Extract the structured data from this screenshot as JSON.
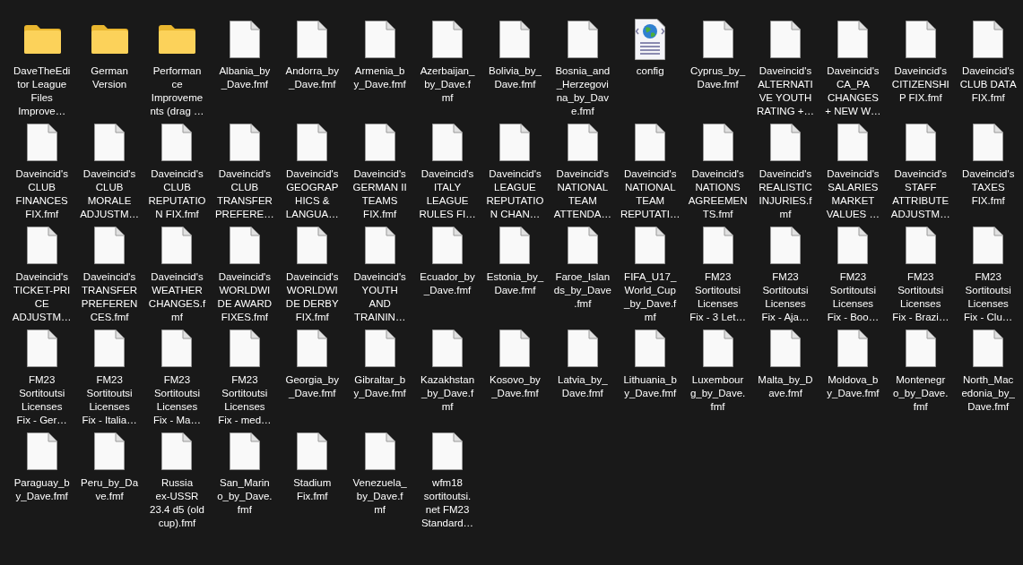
{
  "items": [
    {
      "kind": "folder",
      "lines": [
        "DaveTheEdi",
        "tor League",
        "Files",
        "Improve…"
      ]
    },
    {
      "kind": "folder",
      "lines": [
        "German",
        "Version"
      ]
    },
    {
      "kind": "folder",
      "lines": [
        "Performan",
        "ce",
        "Improveme",
        "nts (drag …"
      ]
    },
    {
      "kind": "file",
      "lines": [
        "Albania_by",
        "_Dave.fmf"
      ]
    },
    {
      "kind": "file",
      "lines": [
        "Andorra_by",
        "_Dave.fmf"
      ]
    },
    {
      "kind": "file",
      "lines": [
        "Armenia_b",
        "y_Dave.fmf"
      ]
    },
    {
      "kind": "file",
      "lines": [
        "Azerbaijan_",
        "by_Dave.f",
        "mf"
      ]
    },
    {
      "kind": "file",
      "lines": [
        "Bolivia_by_",
        "Dave.fmf"
      ]
    },
    {
      "kind": "file",
      "lines": [
        "Bosnia_and",
        "_Herzegovi",
        "na_by_Dav",
        "e.fmf"
      ]
    },
    {
      "kind": "web",
      "lines": [
        "config"
      ]
    },
    {
      "kind": "file",
      "lines": [
        "Cyprus_by_",
        "Dave.fmf"
      ]
    },
    {
      "kind": "file",
      "lines": [
        "Daveincid's",
        "ALTERNATI",
        "VE YOUTH",
        "RATING +…"
      ]
    },
    {
      "kind": "file",
      "lines": [
        "Daveincid's",
        "CA_PA",
        "CHANGES",
        "+ NEW W…"
      ]
    },
    {
      "kind": "file",
      "lines": [
        "Daveincid's",
        "CITIZENSHI",
        "P FIX.fmf"
      ]
    },
    {
      "kind": "file",
      "lines": [
        "Daveincid's",
        "CLUB DATA",
        "FIX.fmf"
      ]
    },
    {
      "kind": "file",
      "lines": [
        "Daveincid's",
        "CLUB",
        "FINANCES",
        "FIX.fmf"
      ]
    },
    {
      "kind": "file",
      "lines": [
        "Daveincid's",
        "CLUB",
        "MORALE",
        "ADJUSTM…"
      ]
    },
    {
      "kind": "file",
      "lines": [
        "Daveincid's",
        "CLUB",
        "REPUTATIO",
        "N FIX.fmf"
      ]
    },
    {
      "kind": "file",
      "lines": [
        "Daveincid's",
        "CLUB",
        "TRANSFER",
        "PREFERE…"
      ]
    },
    {
      "kind": "file",
      "lines": [
        "Daveincid's",
        "GEOGRAP",
        "HICS &",
        "LANGUA…"
      ]
    },
    {
      "kind": "file",
      "lines": [
        "Daveincid's",
        "GERMAN II",
        "TEAMS",
        "FIX.fmf"
      ]
    },
    {
      "kind": "file",
      "lines": [
        "Daveincid's",
        "ITALY",
        "LEAGUE",
        "RULES FI…"
      ]
    },
    {
      "kind": "file",
      "lines": [
        "Daveincid's",
        "LEAGUE",
        "REPUTATIO",
        "N CHAN…"
      ]
    },
    {
      "kind": "file",
      "lines": [
        "Daveincid's",
        "NATIONAL",
        "TEAM",
        "ATTENDA…"
      ]
    },
    {
      "kind": "file",
      "lines": [
        "Daveincid's",
        "NATIONAL",
        "TEAM",
        "REPUTATI…"
      ]
    },
    {
      "kind": "file",
      "lines": [
        "Daveincid's",
        "NATIONS",
        "AGREEMEN",
        "TS.fmf"
      ]
    },
    {
      "kind": "file",
      "lines": [
        "Daveincid's",
        "REALISTIC",
        "INJURIES.f",
        "mf"
      ]
    },
    {
      "kind": "file",
      "lines": [
        "Daveincid's",
        "SALARIES",
        "MARKET",
        "VALUES …"
      ]
    },
    {
      "kind": "file",
      "lines": [
        "Daveincid's",
        "STAFF",
        "ATTRIBUTE",
        "ADJUSTM…"
      ]
    },
    {
      "kind": "file",
      "lines": [
        "Daveincid's",
        "TAXES",
        "FIX.fmf"
      ]
    },
    {
      "kind": "file",
      "lines": [
        "Daveincid's",
        "TICKET-PRI",
        "CE",
        "ADJUSTM…"
      ]
    },
    {
      "kind": "file",
      "lines": [
        "Daveincid's",
        "TRANSFER",
        "PREFEREN",
        "CES.fmf"
      ]
    },
    {
      "kind": "file",
      "lines": [
        "Daveincid's",
        "WEATHER",
        "CHANGES.f",
        "mf"
      ]
    },
    {
      "kind": "file",
      "lines": [
        "Daveincid's",
        "WORLDWI",
        "DE AWARD",
        "FIXES.fmf"
      ]
    },
    {
      "kind": "file",
      "lines": [
        "Daveincid's",
        "WORLDWI",
        "DE DERBY",
        "FIX.fmf"
      ]
    },
    {
      "kind": "file",
      "lines": [
        "Daveincid's",
        "YOUTH",
        "AND",
        "TRAININ…"
      ]
    },
    {
      "kind": "file",
      "lines": [
        "Ecuador_by",
        "_Dave.fmf"
      ]
    },
    {
      "kind": "file",
      "lines": [
        "Estonia_by_",
        "Dave.fmf"
      ]
    },
    {
      "kind": "file",
      "lines": [
        "Faroe_Islan",
        "ds_by_Dave",
        ".fmf"
      ]
    },
    {
      "kind": "file",
      "lines": [
        "FIFA_U17_",
        "World_Cup",
        "_by_Dave.f",
        "mf"
      ]
    },
    {
      "kind": "file",
      "lines": [
        "FM23",
        "Sortitoutsi",
        "Licenses",
        "Fix - 3 Let…"
      ]
    },
    {
      "kind": "file",
      "lines": [
        "FM23",
        "Sortitoutsi",
        "Licenses",
        "Fix - Aja…"
      ]
    },
    {
      "kind": "file",
      "lines": [
        "FM23",
        "Sortitoutsi",
        "Licenses",
        "Fix - Boo…"
      ]
    },
    {
      "kind": "file",
      "lines": [
        "FM23",
        "Sortitoutsi",
        "Licenses",
        "Fix - Brazi…"
      ]
    },
    {
      "kind": "file",
      "lines": [
        "FM23",
        "Sortitoutsi",
        "Licenses",
        "Fix - Clu…"
      ]
    },
    {
      "kind": "file",
      "lines": [
        "FM23",
        "Sortitoutsi",
        "Licenses",
        "Fix - Ger…"
      ]
    },
    {
      "kind": "file",
      "lines": [
        "FM23",
        "Sortitoutsi",
        "Licenses",
        "Fix - Italia…"
      ]
    },
    {
      "kind": "file",
      "lines": [
        "FM23",
        "Sortitoutsi",
        "Licenses",
        "Fix - Ma…"
      ]
    },
    {
      "kind": "file",
      "lines": [
        "FM23",
        "Sortitoutsi",
        "Licenses",
        "Fix - med…"
      ]
    },
    {
      "kind": "file",
      "lines": [
        "Georgia_by",
        "_Dave.fmf"
      ]
    },
    {
      "kind": "file",
      "lines": [
        "Gibraltar_b",
        "y_Dave.fmf"
      ]
    },
    {
      "kind": "file",
      "lines": [
        "Kazakhstan",
        "_by_Dave.f",
        "mf"
      ]
    },
    {
      "kind": "file",
      "lines": [
        "Kosovo_by",
        "_Dave.fmf"
      ]
    },
    {
      "kind": "file",
      "lines": [
        "Latvia_by_",
        "Dave.fmf"
      ]
    },
    {
      "kind": "file",
      "lines": [
        "Lithuania_b",
        "y_Dave.fmf"
      ]
    },
    {
      "kind": "file",
      "lines": [
        "Luxembour",
        "g_by_Dave.",
        "fmf"
      ]
    },
    {
      "kind": "file",
      "lines": [
        "Malta_by_D",
        "ave.fmf"
      ]
    },
    {
      "kind": "file",
      "lines": [
        "Moldova_b",
        "y_Dave.fmf"
      ]
    },
    {
      "kind": "file",
      "lines": [
        "Montenegr",
        "o_by_Dave.",
        "fmf"
      ]
    },
    {
      "kind": "file",
      "lines": [
        "North_Mac",
        "edonia_by_",
        "Dave.fmf"
      ]
    },
    {
      "kind": "file",
      "lines": [
        "Paraguay_b",
        "y_Dave.fmf"
      ]
    },
    {
      "kind": "file",
      "lines": [
        "Peru_by_Da",
        "ve.fmf"
      ]
    },
    {
      "kind": "file",
      "lines": [
        "Russia",
        "ex-USSR",
        "23.4 d5 (old",
        "cup).fmf"
      ]
    },
    {
      "kind": "file",
      "lines": [
        "San_Marin",
        "o_by_Dave.",
        "fmf"
      ]
    },
    {
      "kind": "file",
      "lines": [
        "Stadium",
        "Fix.fmf"
      ]
    },
    {
      "kind": "file",
      "lines": [
        "Venezuela_",
        "by_Dave.f",
        "mf"
      ]
    },
    {
      "kind": "file",
      "lines": [
        "wfm18",
        "sortitoutsi.",
        "net FM23",
        "Standard…"
      ]
    }
  ]
}
